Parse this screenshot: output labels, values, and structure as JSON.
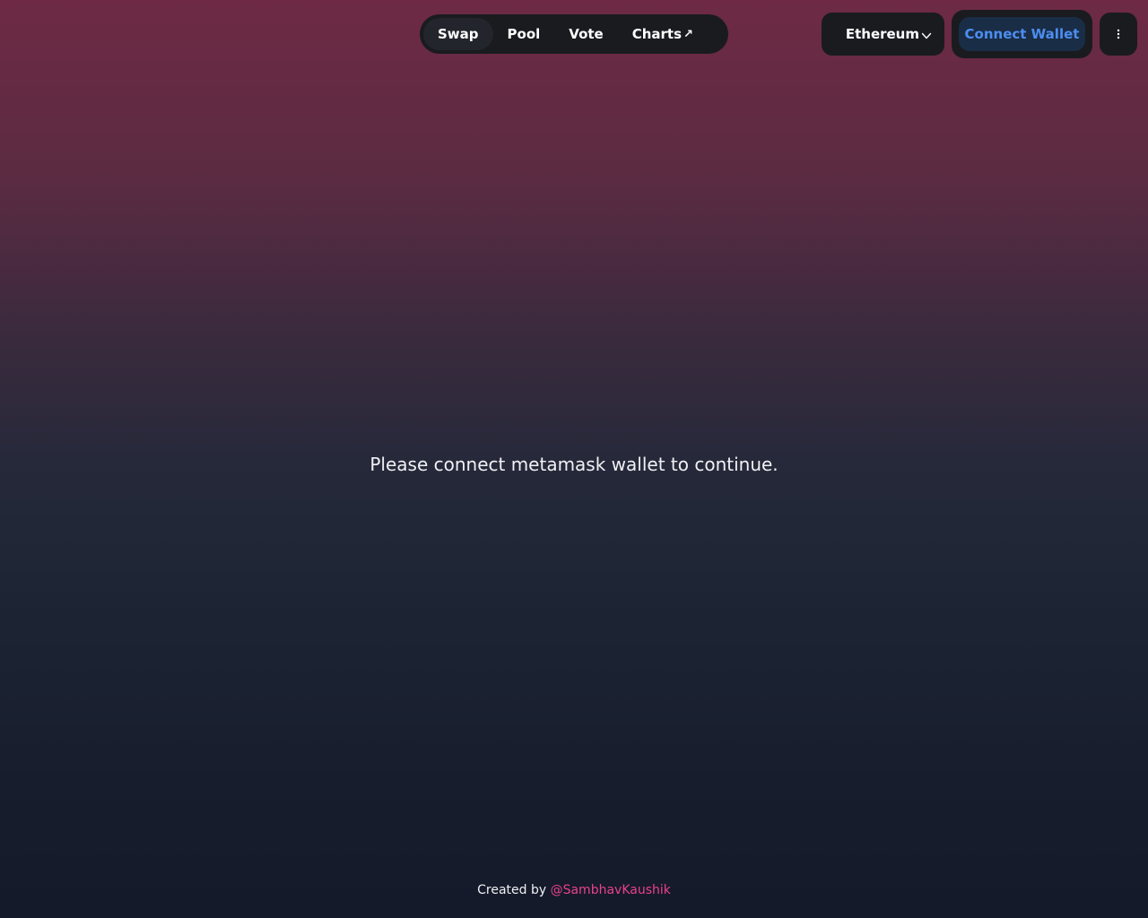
{
  "nav": {
    "tabs": [
      {
        "label": "Swap",
        "active": true
      },
      {
        "label": "Pool",
        "active": false
      },
      {
        "label": "Vote",
        "active": false
      },
      {
        "label": "Charts",
        "active": false,
        "external": true
      }
    ],
    "external_glyph": "↗"
  },
  "network": {
    "label": "Ethereum",
    "icon": "chevron-down-icon"
  },
  "wallet": {
    "connect_label": "Connect Wallet"
  },
  "menu": {
    "icon": "more-vertical-icon"
  },
  "main": {
    "message": "Please connect metamask wallet to continue."
  },
  "footer": {
    "prefix": "Created by ",
    "author": "@SambhavKaushik"
  },
  "colors": {
    "accent_blue": "#4c8ef0",
    "link_pink": "#e8418c",
    "panel_dark": "#191b1f"
  }
}
